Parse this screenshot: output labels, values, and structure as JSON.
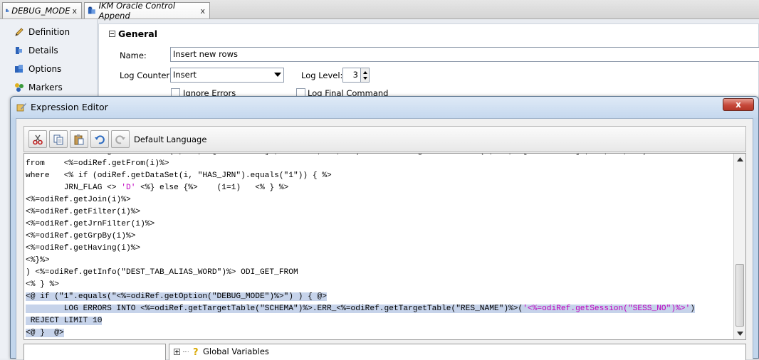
{
  "tabs": [
    {
      "label": "DEBUG_MODE",
      "close": "x"
    },
    {
      "label": "IKM Oracle Control Append",
      "close": "x"
    }
  ],
  "nav": [
    {
      "label": "Definition",
      "icon": "pencil-icon"
    },
    {
      "label": "Details",
      "icon": "puzzle-icon"
    },
    {
      "label": "Options",
      "icon": "puzzle-icon"
    },
    {
      "label": "Markers",
      "icon": "markers-icon"
    }
  ],
  "general": {
    "title": "General",
    "name_label": "Name:",
    "name_value": "Insert new rows",
    "log_counter_label": "Log Counter:",
    "log_counter_value": "Insert",
    "log_level_label": "Log Level:",
    "log_level_value": "3",
    "ignore_errors_label": "Ignore Errors",
    "log_final_label": "Log Final Command"
  },
  "dialog": {
    "title": "Expression Editor",
    "close": "x",
    "language_label": "Default Language",
    "code_lines": [
      {
        "text": "       <%=odiRef.getFilterList(i, \"\", \"[EXPRESSION]\", \" and \", \"\", \"\")%><%=odiRef.getFilterList(i, \"\", \"[EXPRESSION]\", \"\", \"\", \"\")%>",
        "selected": false
      },
      {
        "text": "from    <%=odiRef.getFrom(i)%>",
        "selected": false
      },
      {
        "text": "where   <% if (odiRef.getDataSet(i, \"HAS_JRN\").equals(\"1\")) { %>",
        "selected": false
      },
      {
        "text": "        JRN_FLAG <> ",
        "pink": "'D'",
        "after": " <%} else {%>    (1=1)   <% } %>",
        "selected": false
      },
      {
        "text": "<%=odiRef.getJoin(i)%>",
        "selected": false
      },
      {
        "text": "<%=odiRef.getFilter(i)%>",
        "selected": false
      },
      {
        "text": "<%=odiRef.getJrnFilter(i)%>",
        "selected": false
      },
      {
        "text": "<%=odiRef.getGrpBy(i)%>",
        "selected": false
      },
      {
        "text": "<%=odiRef.getHaving(i)%>",
        "selected": false
      },
      {
        "text": "<%}%>",
        "selected": false
      },
      {
        "text": ") <%=odiRef.getInfo(\"DEST_TAB_ALIAS_WORD\")%> ODI_GET_FROM",
        "selected": false
      },
      {
        "text": "<% } %>",
        "selected": false
      },
      {
        "text": "<@ if (\"1\".equals(\"<%=odiRef.getOption(\"DEBUG_MODE\")%>\") ) { @>",
        "selected": true
      },
      {
        "text": "        LOG ERRORS INTO <%=odiRef.getTargetTable(\"SCHEMA\")%>.ERR_<%=odiRef.getTargetTable(\"RES_NAME\")%>(",
        "pink": "'<%=odiRef.getSession(\"SESS_NO\")%>'",
        "after": ")",
        "selected": true
      },
      {
        "text": " REJECT LIMIT 10",
        "selected": true
      },
      {
        "text": "<@ }  @>",
        "selected": true
      }
    ],
    "tree_item": "Global Variables"
  }
}
